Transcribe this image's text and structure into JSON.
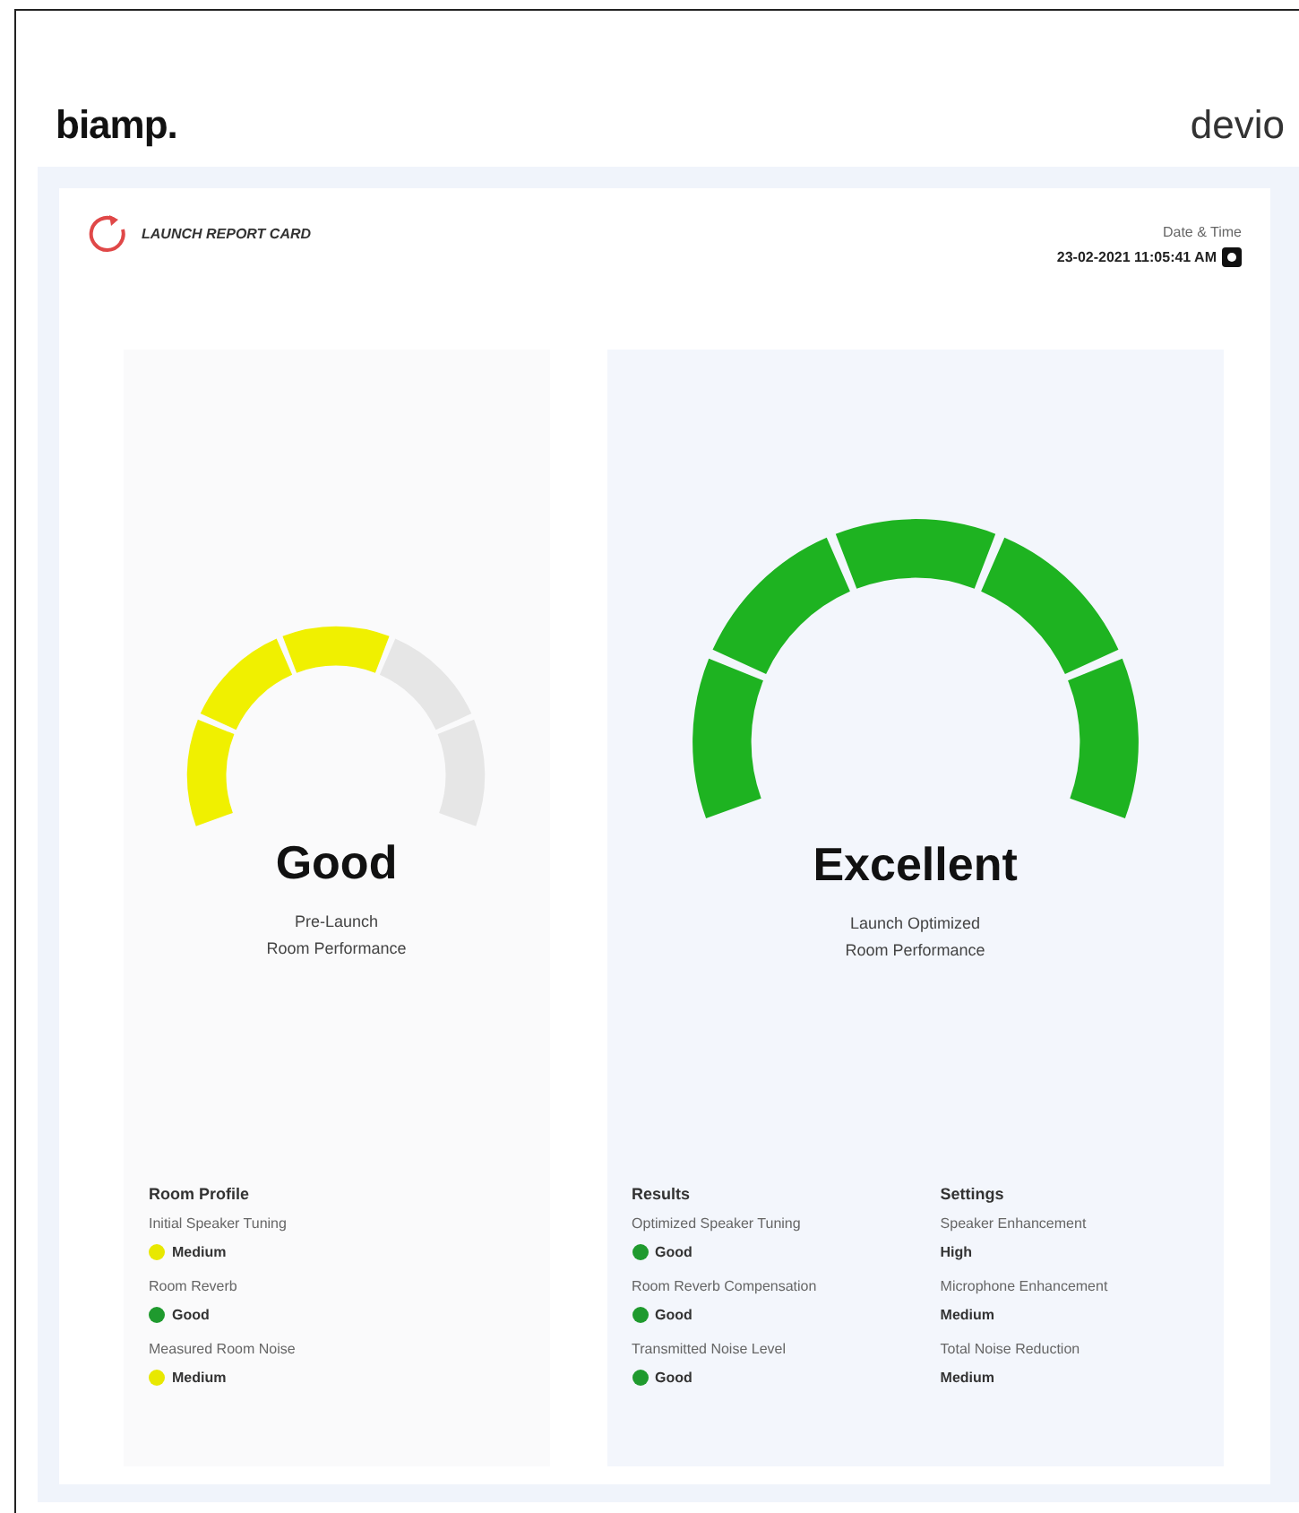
{
  "brand": {
    "logo": "biamp.",
    "product": "devio"
  },
  "report": {
    "title": "LAUNCH REPORT CARD",
    "date_label": "Date & Time",
    "date_value": "23-02-2021 11:05:41 AM"
  },
  "panels": [
    {
      "wide": false,
      "rating": "Good",
      "subtitle": [
        "Pre-Launch",
        "Room Performance"
      ],
      "gauge": {
        "color": "#f0f000",
        "segments": [
          {
            "on": true
          },
          {
            "on": true
          },
          {
            "on": true
          },
          {
            "on": false
          },
          {
            "on": false
          }
        ]
      },
      "sections": [
        {
          "title": "Room Profile",
          "items": [
            {
              "label": "Initial Speaker Tuning",
              "value": "Medium",
              "color": "#e8e800"
            },
            {
              "label": "Room Reverb",
              "value": "Good",
              "color": "#1f9a2e"
            },
            {
              "label": "Measured Room Noise",
              "value": "Medium",
              "color": "#e8e800"
            }
          ]
        }
      ]
    },
    {
      "wide": true,
      "rating": "Excellent",
      "subtitle": [
        "Launch Optimized",
        "Room Performance"
      ],
      "gauge": {
        "color": "#1eb321",
        "segments": [
          {
            "on": true
          },
          {
            "on": true
          },
          {
            "on": true
          },
          {
            "on": true
          },
          {
            "on": true
          }
        ]
      },
      "sections": [
        {
          "title": "Results",
          "items": [
            {
              "label": "Optimized Speaker Tuning",
              "value": "Good",
              "color": "#1f9a2e"
            },
            {
              "label": "Room Reverb Compensation",
              "value": "Good",
              "color": "#1f9a2e"
            },
            {
              "label": "Transmitted Noise Level",
              "value": "Good",
              "color": "#1f9a2e"
            }
          ]
        },
        {
          "title": "Settings",
          "items": [
            {
              "label": "Speaker Enhancement",
              "value": "High"
            },
            {
              "label": "Microphone Enhancement",
              "value": "Medium"
            },
            {
              "label": "Total Noise Reduction",
              "value": "Medium"
            }
          ]
        }
      ]
    }
  ]
}
